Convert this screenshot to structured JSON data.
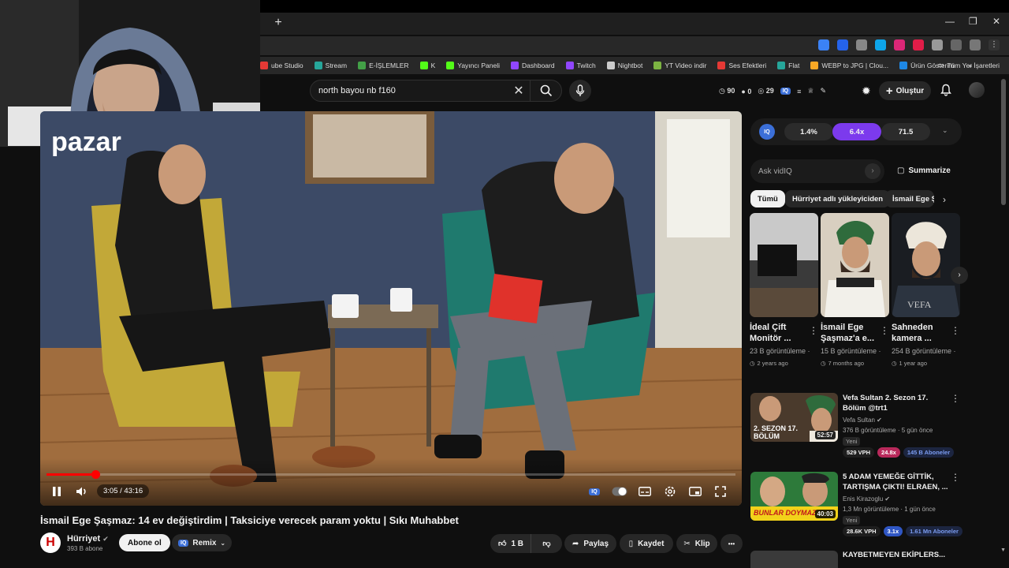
{
  "browser": {
    "new_tab_symbol": "+",
    "window_controls": {
      "minimize": "—",
      "restore": "❐",
      "close": "✕"
    },
    "bookmarks": [
      {
        "label": "ube Studio",
        "color": "#e53935"
      },
      {
        "label": "Stream",
        "color": "#26a69a"
      },
      {
        "label": "E-İŞLEMLER",
        "color": "#43a047"
      },
      {
        "label": "K",
        "color": "#53fc18"
      },
      {
        "label": "Yayıncı Paneli",
        "color": "#53fc18"
      },
      {
        "label": "Dashboard",
        "color": "#9146ff"
      },
      {
        "label": "Twitch",
        "color": "#9146ff"
      },
      {
        "label": "Nightbot",
        "color": "#cccccc"
      },
      {
        "label": "YT Video indir",
        "color": "#7cb342"
      },
      {
        "label": "Ses Efektleri",
        "color": "#e53935"
      },
      {
        "label": "Flat",
        "color": "#26a69a"
      },
      {
        "label": "WEBP to JPG | Clou...",
        "color": "#f9a825"
      },
      {
        "label": "Ürün Gösterim",
        "color": "#1e88e5"
      }
    ],
    "bookmarks_overflow": "»",
    "all_bookmarks": "Tüm Yer İşaretleri"
  },
  "header": {
    "search_value": "north bayou nb f160",
    "stats": {
      "views": "90",
      "zero": "0",
      "count": "29"
    },
    "create_label": "Oluştur"
  },
  "player": {
    "time": "3:05 / 43:16",
    "progress": 0.0713,
    "overlay_text": "pazar"
  },
  "video": {
    "title": "İsmail Ege Şaşmaz: 14 ev değiştirdim | Taksiciye verecek param yoktu | Sıkı Muhabbet",
    "channel_name": "Hürriyet",
    "channel_logo_letter": "H",
    "channel_subs": "393 B abone",
    "subscribe_label": "Abone ol",
    "remix_label": "Remix",
    "likes": "1 B",
    "share_label": "Paylaş",
    "save_label": "Kaydet",
    "clip_label": "Klip",
    "more_label": "•••"
  },
  "vidiq": {
    "logo": "IQ",
    "metrics": [
      "1.4%",
      "6.4x",
      "71.5"
    ],
    "ask_placeholder": "Ask vidIQ",
    "summarize_label": "Summarize"
  },
  "chips": [
    "Tümü",
    "Hürriyet adlı yükleyiciden",
    "İsmail Ege Ş"
  ],
  "shorts": [
    {
      "title": "İdeal Çift Monitör ...",
      "views": "23 B görüntüleme ·",
      "ago": "2 years ago"
    },
    {
      "title": "İsmail Ege Şaşmaz'a e...",
      "views": "15 B görüntüleme ·",
      "ago": "7 months ago"
    },
    {
      "title": "Sahneden kamera ...",
      "views": "254 B görüntüleme ·",
      "ago": "1 year ago"
    }
  ],
  "recommended": [
    {
      "title": "Vefa Sultan 2. Sezon 17. Bölüm @trt1",
      "channel": "Vefa Sultan",
      "meta": "376 B görüntüleme · 5 gün önce",
      "badge_new": "Yeni",
      "duration": "52:57",
      "vph": "529 VPH",
      "multiplier": "24.8x",
      "subs": "145 B Aboneler",
      "thumb_text": "2. SEZON 17. BÖLÜM"
    },
    {
      "title": "5 ADAM YEMEĞE GİTTİK, TARTIŞMA ÇIKTI! ELRAEN, ...",
      "channel": "Enis Kirazoglu",
      "meta": "1,3 Mn görüntüleme · 1 gün önce",
      "badge_new": "Yeni",
      "duration": "40:03",
      "vph": "28.6K VPH",
      "multiplier": "3.1x",
      "subs": "1.61 Mn Aboneler",
      "thumb_text": "BUNLAR DOYMAZ"
    }
  ],
  "next_partial_title": "KAYBETMEYEN EKİPLERS..."
}
